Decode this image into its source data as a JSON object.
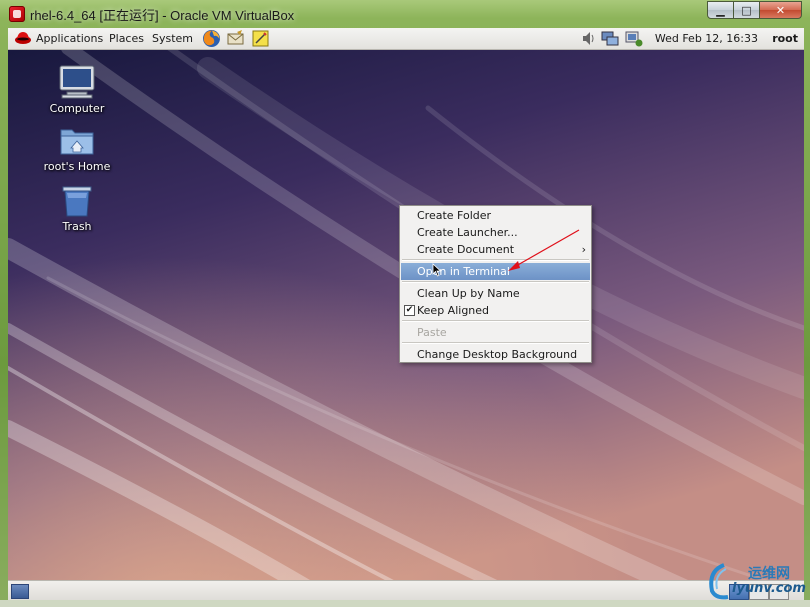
{
  "host_window": {
    "title": "rhel-6.4_64 [正在运行] - Oracle VM VirtualBox",
    "minimize_glyph": "▁",
    "maximize_glyph": "□",
    "close_glyph": "✕"
  },
  "top_panel": {
    "menus": [
      "Applications",
      "Places",
      "System"
    ],
    "launchers": [
      "firefox-icon",
      "mail-icon",
      "notes-icon"
    ],
    "tray_icons": [
      "volume-icon",
      "network-icon",
      "update-icon"
    ],
    "clock": "Wed Feb 12, 16:33",
    "user": "root"
  },
  "desktop_icons": [
    {
      "label": "Computer",
      "icon": "computer-icon"
    },
    {
      "label": "root's Home",
      "icon": "home-folder-icon"
    },
    {
      "label": "Trash",
      "icon": "trash-icon"
    }
  ],
  "context_menu": {
    "items": [
      {
        "label": "Create Folder",
        "state": "normal"
      },
      {
        "label": "Create Launcher...",
        "state": "normal"
      },
      {
        "label": "Create Document",
        "state": "normal",
        "submenu": true
      },
      {
        "label": "Open in Terminal",
        "state": "highlighted"
      },
      {
        "label": "Clean Up by Name",
        "state": "normal"
      },
      {
        "label": "Keep Aligned",
        "state": "checked"
      },
      {
        "label": "Paste",
        "state": "disabled"
      },
      {
        "label": "Change Desktop Background",
        "state": "normal"
      }
    ],
    "submenu_glyph": "›",
    "check_glyph": "✔"
  },
  "watermark": {
    "line1": "运维网",
    "line2": "iyunv.com"
  },
  "colors": {
    "highlight": "#6d92c6",
    "annotation_arrow": "#e0101a"
  }
}
